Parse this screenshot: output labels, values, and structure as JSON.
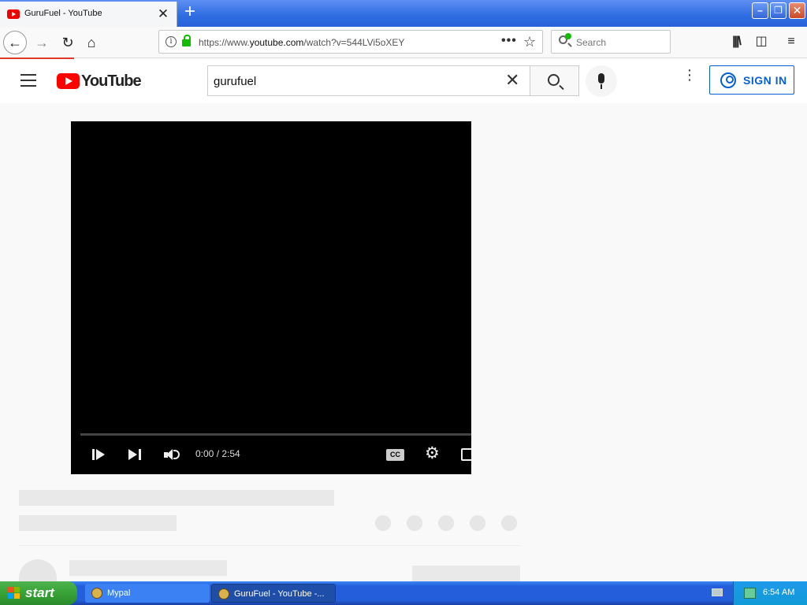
{
  "browser": {
    "tab": {
      "title": "GuruFuel - YouTube",
      "close_glyph": "✕",
      "favicon": "youtube-favicon"
    },
    "new_tab_glyph": "+",
    "window_controls": {
      "minimize": "–",
      "maximize": "❐",
      "close": "✕"
    },
    "nav": {
      "back_glyph": "←",
      "forward_glyph": "→",
      "reload_glyph": "↻",
      "home_glyph": "⌂"
    },
    "url": {
      "prefix": "https://www.",
      "domain": "youtube.com",
      "path": "/watch?v=544LVi5oXEY",
      "actions_glyph": "•••",
      "bookmark_glyph": "☆"
    },
    "search": {
      "placeholder": "Search"
    },
    "toolbar": {
      "library_glyph": "|||\\",
      "sidebar_glyph": "◫",
      "menu_glyph": "≡"
    }
  },
  "youtube": {
    "logo_text": "YouTube",
    "search_query": "gurufuel",
    "clear_glyph": "✕",
    "more_glyph": "⋮",
    "sign_in_label": "SIGN IN"
  },
  "player": {
    "time": "0:00 / 2:54",
    "progress": 0,
    "cc_label": "CC",
    "settings_glyph": "⚙"
  },
  "taskbar": {
    "start_label": "start",
    "tasks": [
      {
        "label": "Mypal"
      },
      {
        "label": "GuruFuel - YouTube -..."
      }
    ],
    "clock": "6:54 AM"
  },
  "colors": {
    "accent_blue": "#065fd4",
    "youtube_red": "#ff0000",
    "xp_blue": "#245edb",
    "xp_green": "#37a236",
    "secure_green": "#12bc00"
  }
}
